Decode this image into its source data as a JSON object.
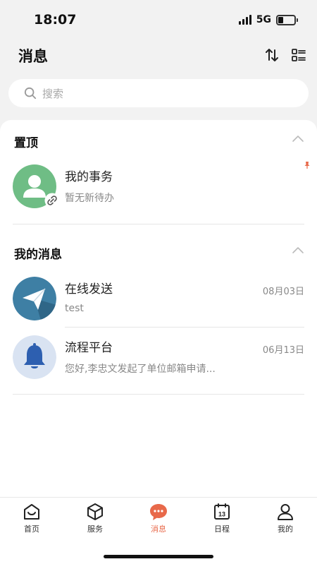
{
  "status_bar": {
    "time": "18:07",
    "network": "5G"
  },
  "header": {
    "title": "消息"
  },
  "search": {
    "placeholder": "搜索"
  },
  "pinned": {
    "title": "置顶",
    "items": [
      {
        "title": "我的事务",
        "subtitle": "暂无新待办",
        "avatar_color": "#6fbd85"
      }
    ]
  },
  "messages": {
    "title": "我的消息",
    "items": [
      {
        "title": "在线发送",
        "subtitle": "test",
        "date": "08月03日",
        "avatar_color": "#3e7fa4"
      },
      {
        "title": "流程平台",
        "subtitle": "您好,李忠文发起了单位邮箱申请...",
        "date": "06月13日",
        "avatar_color": "#d9e3f2"
      }
    ]
  },
  "tabs": [
    {
      "label": "首页",
      "icon": "home-icon",
      "active": false
    },
    {
      "label": "服务",
      "icon": "cube-icon",
      "active": false
    },
    {
      "label": "消息",
      "icon": "chat-bubble-icon",
      "active": true
    },
    {
      "label": "日程",
      "icon": "calendar-icon",
      "active": false
    },
    {
      "label": "我的",
      "icon": "person-icon",
      "active": false
    }
  ],
  "colors": {
    "accent": "#e8694a",
    "text_primary": "#222222",
    "text_secondary": "#888888"
  }
}
